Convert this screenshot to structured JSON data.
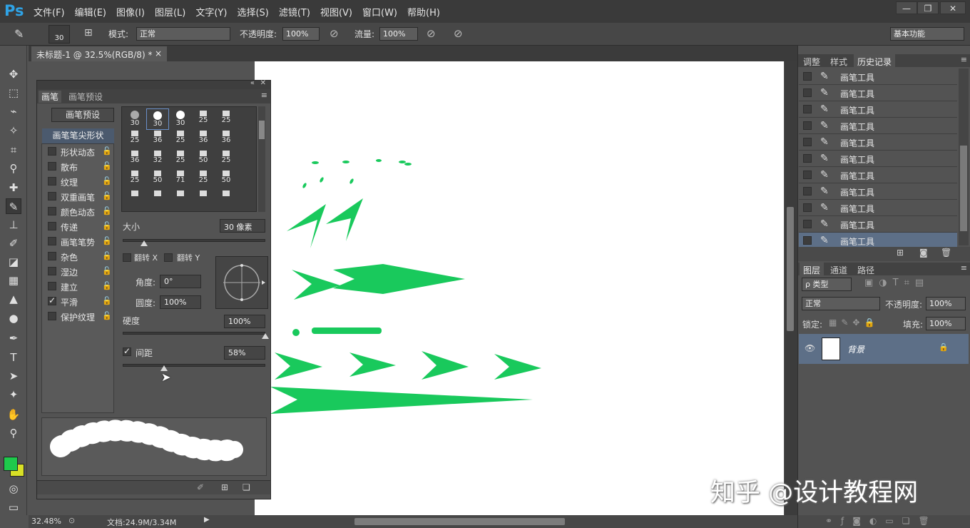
{
  "app": {
    "logo": "Ps"
  },
  "menubar": {
    "items": [
      "文件(F)",
      "编辑(E)",
      "图像(I)",
      "图层(L)",
      "文字(Y)",
      "选择(S)",
      "滤镜(T)",
      "视图(V)",
      "窗口(W)",
      "帮助(H)"
    ]
  },
  "window_controls": {
    "minimize": "—",
    "restore": "❐",
    "close": "✕"
  },
  "options": {
    "brush_size": "30",
    "mode_label": "模式:",
    "mode_value": "正常",
    "opacity_label": "不透明度:",
    "opacity_value": "100%",
    "flow_label": "流量:",
    "flow_value": "100%",
    "workspace": "基本功能"
  },
  "document": {
    "tab_title": "未标题-1 @ 32.5%(RGB/8) *",
    "close": "×"
  },
  "status": {
    "zoom": "32.48%",
    "doc_info": "文档:24.9M/3.34M"
  },
  "brush_panel": {
    "tab_brush": "画笔",
    "tab_presets": "画笔预设",
    "preset_button": "画笔预设",
    "tip_shape_label": "画笔笔尖形状",
    "items": [
      {
        "label": "形状动态",
        "checked": false
      },
      {
        "label": "散布",
        "checked": false
      },
      {
        "label": "纹理",
        "checked": false
      },
      {
        "label": "双重画笔",
        "checked": false
      },
      {
        "label": "颜色动态",
        "checked": false
      },
      {
        "label": "传递",
        "checked": false
      },
      {
        "label": "画笔笔势",
        "checked": false
      },
      {
        "label": "杂色",
        "checked": false
      },
      {
        "label": "湿边",
        "checked": false
      },
      {
        "label": "建立",
        "checked": false
      },
      {
        "label": "平滑",
        "checked": true
      },
      {
        "label": "保护纹理",
        "checked": false
      }
    ],
    "tip_sizes": [
      "30",
      "30",
      "30",
      "25",
      "25",
      "25",
      "36",
      "25",
      "36",
      "36",
      "36",
      "32",
      "25",
      "50",
      "25",
      "25",
      "50",
      "71",
      "25",
      "50",
      "",
      "",
      "",
      "",
      ""
    ],
    "size_label": "大小",
    "size_value": "30 像素",
    "flip_x": "翻转 X",
    "flip_y": "翻转 Y",
    "angle_label": "角度:",
    "angle_value": "0°",
    "roundness_label": "圆度:",
    "roundness_value": "100%",
    "hardness_label": "硬度",
    "hardness_value": "100%",
    "spacing_label": "间距",
    "spacing_value": "58%",
    "spacing_checked": true,
    "size_level": 0.15,
    "hardness_level": 1.0,
    "spacing_level": 0.29
  },
  "right_panel": {
    "tabs": [
      "调整",
      "样式",
      "历史记录"
    ],
    "history": [
      "画笔工具",
      "画笔工具",
      "画笔工具",
      "画笔工具",
      "画笔工具",
      "画笔工具",
      "画笔工具",
      "画笔工具",
      "画笔工具",
      "画笔工具",
      "画笔工具"
    ],
    "layer_tabs": [
      "图层",
      "通道",
      "路径"
    ],
    "filter_type": "ρ 类型",
    "blend_mode": "正常",
    "opacity_label": "不透明度:",
    "opacity_value": "100%",
    "lock_label": "锁定:",
    "fill_label": "填充:",
    "fill_value": "100%",
    "layer_name": "背景"
  },
  "colors": {
    "foreground": "#1ec94c",
    "background": "#d8e026",
    "accent_green": "#19c95c"
  },
  "watermark": "知乎 @设计教程网"
}
